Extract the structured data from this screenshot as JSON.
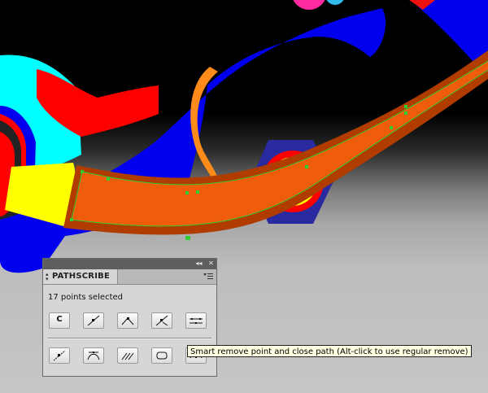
{
  "panel": {
    "title": "PATHSCRIBE",
    "status": "17 points selected",
    "collapse_glyph": "◂◂",
    "close_glyph": "✕",
    "buttons_row1": [
      {
        "id": "convert",
        "label": "C",
        "icon": "convert-letter-icon"
      },
      {
        "id": "line-segment",
        "icon": "line-segment-icon"
      },
      {
        "id": "corner-point",
        "icon": "corner-point-icon"
      },
      {
        "id": "remove-point",
        "icon": "remove-point-icon"
      },
      {
        "id": "distribute",
        "icon": "distribute-handles-icon"
      }
    ],
    "buttons_row2": [
      {
        "id": "smooth-line",
        "icon": "smooth-line-icon"
      },
      {
        "id": "handles",
        "icon": "handles-icon"
      },
      {
        "id": "multi-segment",
        "icon": "multi-segment-icon"
      },
      {
        "id": "close-shape",
        "icon": "close-shape-icon"
      },
      {
        "id": "smart-remove",
        "icon": "smart-remove-close-icon"
      }
    ]
  },
  "tooltip": {
    "text": "Smart remove point and close path (Alt-click to use regular remove)"
  },
  "colors": {
    "selection": "#33cc33",
    "panel_bg": "#d6d6d6"
  }
}
